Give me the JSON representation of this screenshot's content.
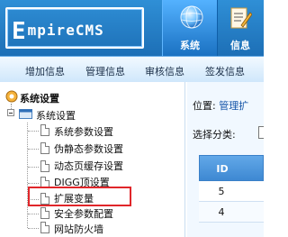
{
  "header": {
    "logo_cap": "E",
    "logo_mid": "mpireCMS",
    "nav": [
      {
        "label": "系统",
        "icon": "globe-icon"
      },
      {
        "label": "信息",
        "icon": "document-edit-icon"
      }
    ]
  },
  "submenu": {
    "items": [
      "增加信息",
      "管理信息",
      "审核信息",
      "签发信息"
    ]
  },
  "sidebar": {
    "root_label": "系统设置",
    "folder_label": "系统设置",
    "items": [
      "系统参数设置",
      "伪静态参数设置",
      "动态页缓存设置",
      "DIGG顶设置",
      "扩展变量",
      "安全参数配置",
      "网站防火墙"
    ],
    "highlighted": "扩展变量"
  },
  "main": {
    "location_prefix": "位置:",
    "location_link": "管理扩",
    "filter_label": "选择分类:",
    "table": {
      "header_id": "ID",
      "rows": [
        "5",
        "4"
      ]
    }
  },
  "colors": {
    "header_blue": "#1d6fb6",
    "highlight_red": "#e0262a",
    "link_blue": "#1454a8"
  }
}
